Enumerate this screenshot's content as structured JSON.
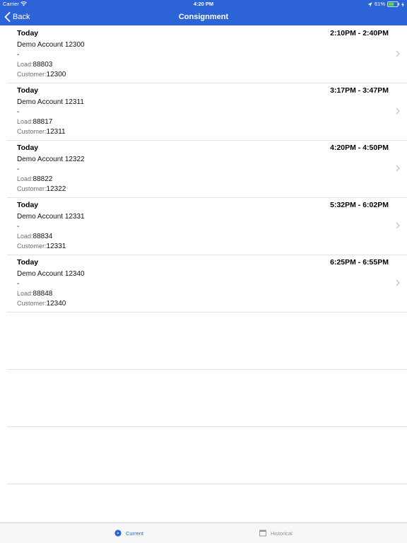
{
  "status_bar": {
    "carrier": "Carrier",
    "time": "4:20 PM",
    "battery": "61%"
  },
  "nav": {
    "back_label": "Back",
    "title": "Consignment"
  },
  "labels": {
    "load": "Load:",
    "customer": "Customer:"
  },
  "consignments": [
    {
      "day": "Today",
      "time": "2:10PM - 2:40PM",
      "account": "Demo Account 12300",
      "detail": "-",
      "load": "88803",
      "customer": "12300"
    },
    {
      "day": "Today",
      "time": "3:17PM - 3:47PM",
      "account": "Demo Account 12311",
      "detail": "-",
      "load": "88817",
      "customer": "12311"
    },
    {
      "day": "Today",
      "time": "4:20PM - 4:50PM",
      "account": "Demo Account 12322",
      "detail": "-",
      "load": "88822",
      "customer": "12322"
    },
    {
      "day": "Today",
      "time": "5:32PM - 6:02PM",
      "account": "Demo Account 12331",
      "detail": "-",
      "load": "88834",
      "customer": "12331"
    },
    {
      "day": "Today",
      "time": "6:25PM - 6:55PM",
      "account": "Demo Account 12340",
      "detail": "-",
      "load": "88848",
      "customer": "12340"
    }
  ],
  "tabs": [
    {
      "label": "Current",
      "icon": "current-dot-icon",
      "selected": true
    },
    {
      "label": "Historical",
      "icon": "calendar-icon",
      "selected": false
    }
  ],
  "colors": {
    "accent": "#2c63d6",
    "separator": "#e3e3e3",
    "tab_inactive": "#8e8e93",
    "battery": "#4cd964"
  }
}
